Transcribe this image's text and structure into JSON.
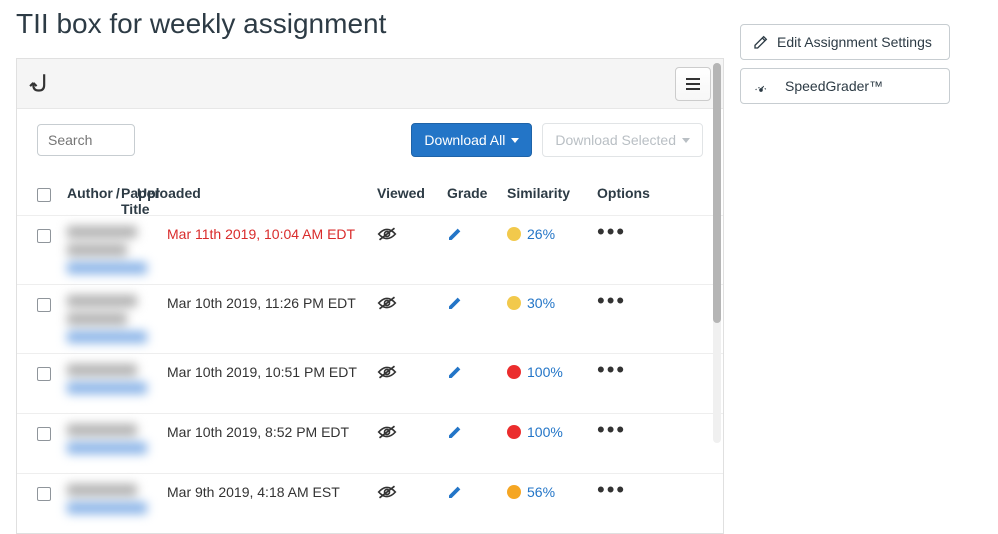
{
  "page": {
    "title": "TII box for weekly assignment"
  },
  "sidebar": {
    "edit_label": "Edit Assignment Settings",
    "speedgrader_label": "SpeedGrader™"
  },
  "toolbar": {
    "search_placeholder": "Search",
    "download_all": "Download All",
    "download_selected": "Download Selected"
  },
  "columns": {
    "author": "Author",
    "paper_title": "Paper Title",
    "uploaded": "Uploaded",
    "viewed": "Viewed",
    "grade": "Grade",
    "similarity": "Similarity",
    "options": "Options"
  },
  "rows": [
    {
      "uploaded": "Mar 11th 2019, 10:04 AM EDT",
      "late": true,
      "similarity_pct": "26%",
      "sim_color": "sim-yellow",
      "author_h": 2
    },
    {
      "uploaded": "Mar 10th 2019, 11:26 PM EDT",
      "late": false,
      "similarity_pct": "30%",
      "sim_color": "sim-yellow",
      "author_h": 2
    },
    {
      "uploaded": "Mar 10th 2019, 10:51 PM EDT",
      "late": false,
      "similarity_pct": "100%",
      "sim_color": "sim-red",
      "author_h": 1
    },
    {
      "uploaded": "Mar 10th 2019, 8:52 PM EDT",
      "late": false,
      "similarity_pct": "100%",
      "sim_color": "sim-red",
      "author_h": 1
    },
    {
      "uploaded": "Mar 9th 2019, 4:18 AM EST",
      "late": false,
      "similarity_pct": "56%",
      "sim_color": "sim-orange",
      "author_h": 1
    }
  ]
}
